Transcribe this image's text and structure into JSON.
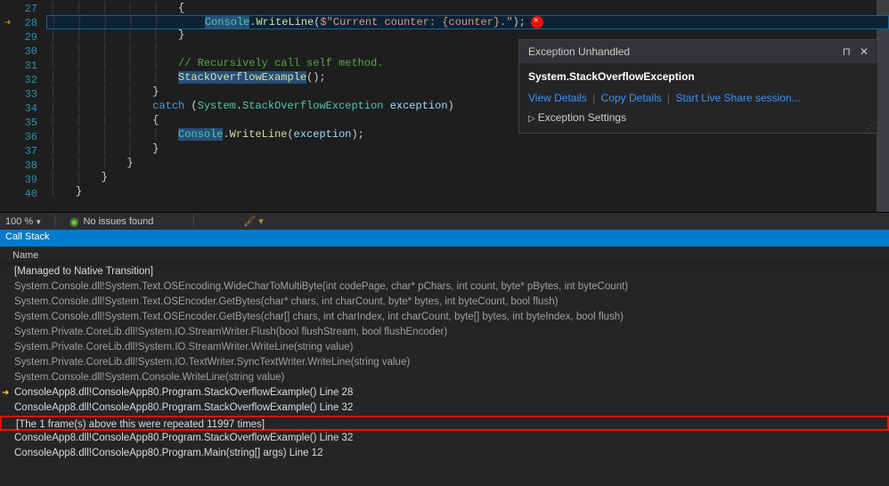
{
  "editor": {
    "line_numbers": [
      27,
      28,
      29,
      30,
      31,
      32,
      33,
      34,
      35,
      36,
      37,
      38,
      39,
      40
    ],
    "active_line": 28,
    "tokens": {
      "Console": "Console",
      "WriteLine": "WriteLine",
      "currentCounter": "$\"Current counter: {counter}.\"",
      "comment": "// Recursively call self method.",
      "StackOverflowExample": "StackOverflowExample",
      "catch": "catch",
      "System": "System",
      "StackOverflowException": "StackOverflowException",
      "exception": "exception"
    }
  },
  "exception_popup": {
    "title": "Exception Unhandled",
    "exception_type": "System.StackOverflowException",
    "links": {
      "view": "View Details",
      "copy": "Copy Details",
      "live_share": "Start Live Share session..."
    },
    "settings": "Exception Settings"
  },
  "status": {
    "zoom": "100 %",
    "issues": "No issues found"
  },
  "callstack": {
    "title": "Call Stack",
    "column_name": "Name",
    "rows": [
      {
        "text": "[Managed to Native Transition]",
        "user": true
      },
      {
        "text": "System.Console.dll!System.Text.OSEncoding.WideCharToMultiByte(int codePage, char* pChars, int count, byte* pBytes, int byteCount)",
        "user": false
      },
      {
        "text": "System.Console.dll!System.Text.OSEncoder.GetBytes(char* chars, int charCount, byte* bytes, int byteCount, bool flush)",
        "user": false
      },
      {
        "text": "System.Console.dll!System.Text.OSEncoder.GetBytes(char[] chars, int charIndex, int charCount, byte[] bytes, int byteIndex, bool flush)",
        "user": false
      },
      {
        "text": "System.Private.CoreLib.dll!System.IO.StreamWriter.Flush(bool flushStream, bool flushEncoder)",
        "user": false
      },
      {
        "text": "System.Private.CoreLib.dll!System.IO.StreamWriter.WriteLine(string value)",
        "user": false
      },
      {
        "text": "System.Private.CoreLib.dll!System.IO.TextWriter.SyncTextWriter.WriteLine(string value)",
        "user": false
      },
      {
        "text": "System.Console.dll!System.Console.WriteLine(string value)",
        "user": false
      },
      {
        "text": "ConsoleApp8.dll!ConsoleApp80.Program.StackOverflowExample() Line 28",
        "user": true,
        "current": true
      },
      {
        "text": "ConsoleApp8.dll!ConsoleApp80.Program.StackOverflowExample() Line 32",
        "user": true
      },
      {
        "text": "[The 1 frame(s) above this were repeated 11997 times]",
        "user": true,
        "boxed": true
      },
      {
        "text": "ConsoleApp8.dll!ConsoleApp80.Program.StackOverflowExample() Line 32",
        "user": true
      },
      {
        "text": "ConsoleApp8.dll!ConsoleApp80.Program.Main(string[] args) Line 12",
        "user": true
      }
    ]
  }
}
